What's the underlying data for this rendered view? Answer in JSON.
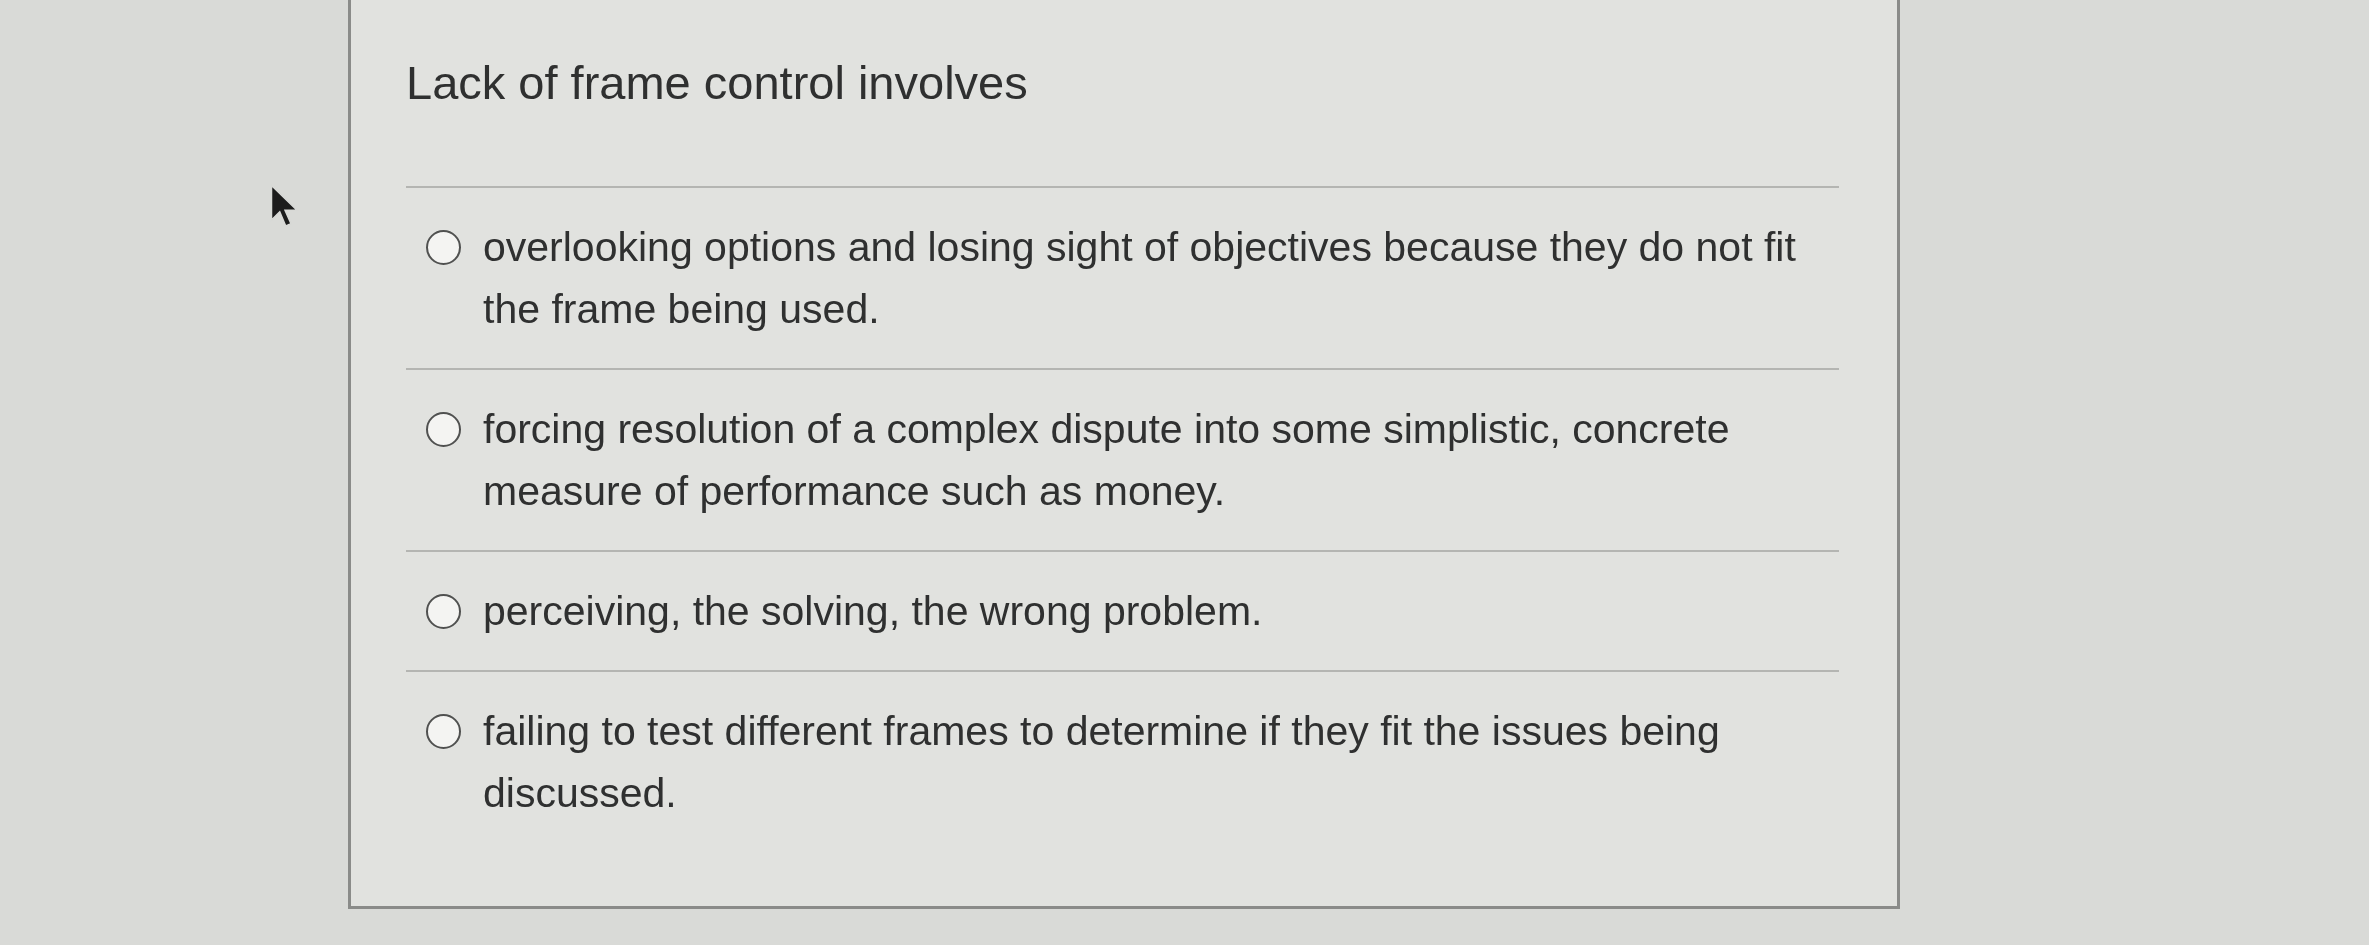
{
  "question": {
    "text": "Lack of frame control involves"
  },
  "options": [
    {
      "text": "overlooking options and losing sight of objectives because they do not fit the frame being used.",
      "selected": false
    },
    {
      "text": "forcing resolution of a complex dispute into some simplistic, concrete measure of performance such as money.",
      "selected": false
    },
    {
      "text": "perceiving, the solving, the wrong problem.",
      "selected": false
    },
    {
      "text": "failing to test different frames to determine if they fit the issues being discussed.",
      "selected": false
    }
  ]
}
